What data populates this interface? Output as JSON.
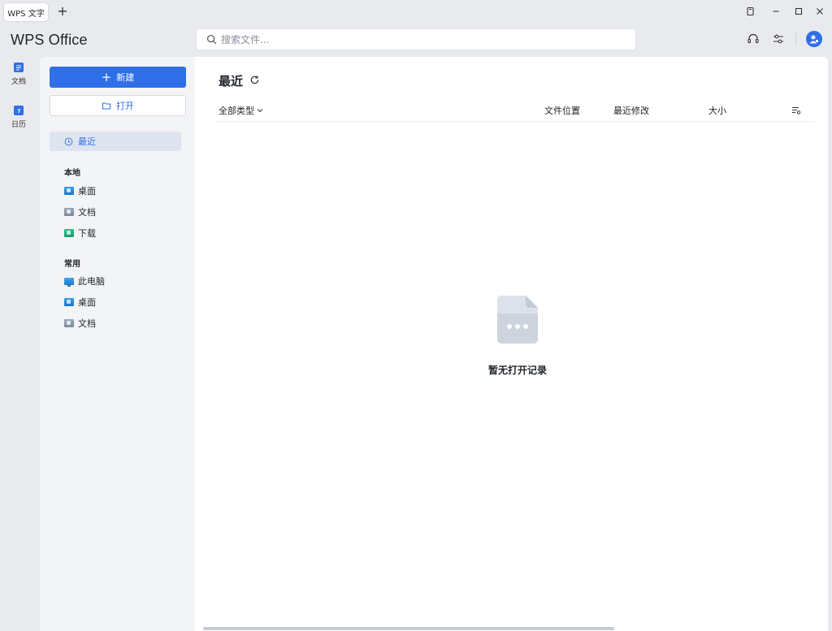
{
  "titlebar": {
    "tab_label": "WPS 文字",
    "add_tab_label": "+"
  },
  "header": {
    "brand": "WPS Office",
    "search_placeholder": "搜索文件..."
  },
  "rail": {
    "items": [
      {
        "label": "文档",
        "icon": "document-icon"
      },
      {
        "label": "日历",
        "icon": "calendar-icon"
      }
    ]
  },
  "sidebar": {
    "new_label": "新建",
    "open_label": "打开",
    "recent_label": "最近",
    "local_title": "本地",
    "local_items": [
      "桌面",
      "文档",
      "下载"
    ],
    "common_title": "常用",
    "common_items": [
      "此电脑",
      "桌面",
      "文档"
    ]
  },
  "main": {
    "title": "最近",
    "filter_label": "全部类型",
    "columns": [
      "文件位置",
      "最近修改",
      "大小"
    ],
    "empty_text": "暂无打开记录"
  },
  "colors": {
    "accent": "#2f6fe8",
    "background": "#e8eaee",
    "panel": "#ffffff",
    "sidebar": "#f3f4f6"
  }
}
